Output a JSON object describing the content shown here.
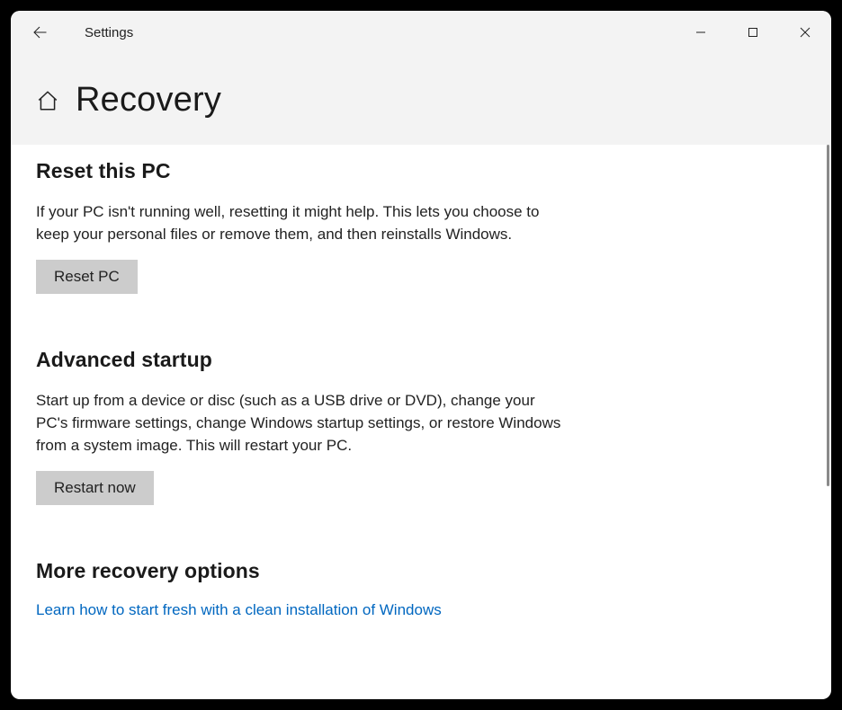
{
  "window": {
    "title": "Settings"
  },
  "page": {
    "title": "Recovery"
  },
  "sections": {
    "reset": {
      "heading": "Reset this PC",
      "body": "If your PC isn't running well, resetting it might help. This lets you choose to keep your personal files or remove them, and then reinstalls Windows.",
      "button_label": "Reset PC"
    },
    "advanced": {
      "heading": "Advanced startup",
      "body": "Start up from a device or disc (such as a USB drive or DVD), change your PC's firmware settings, change Windows startup settings, or restore Windows from a system image. This will restart your PC.",
      "button_label": "Restart now"
    },
    "more": {
      "heading": "More recovery options",
      "link_label": "Learn how to start fresh with a clean installation of Windows"
    }
  }
}
